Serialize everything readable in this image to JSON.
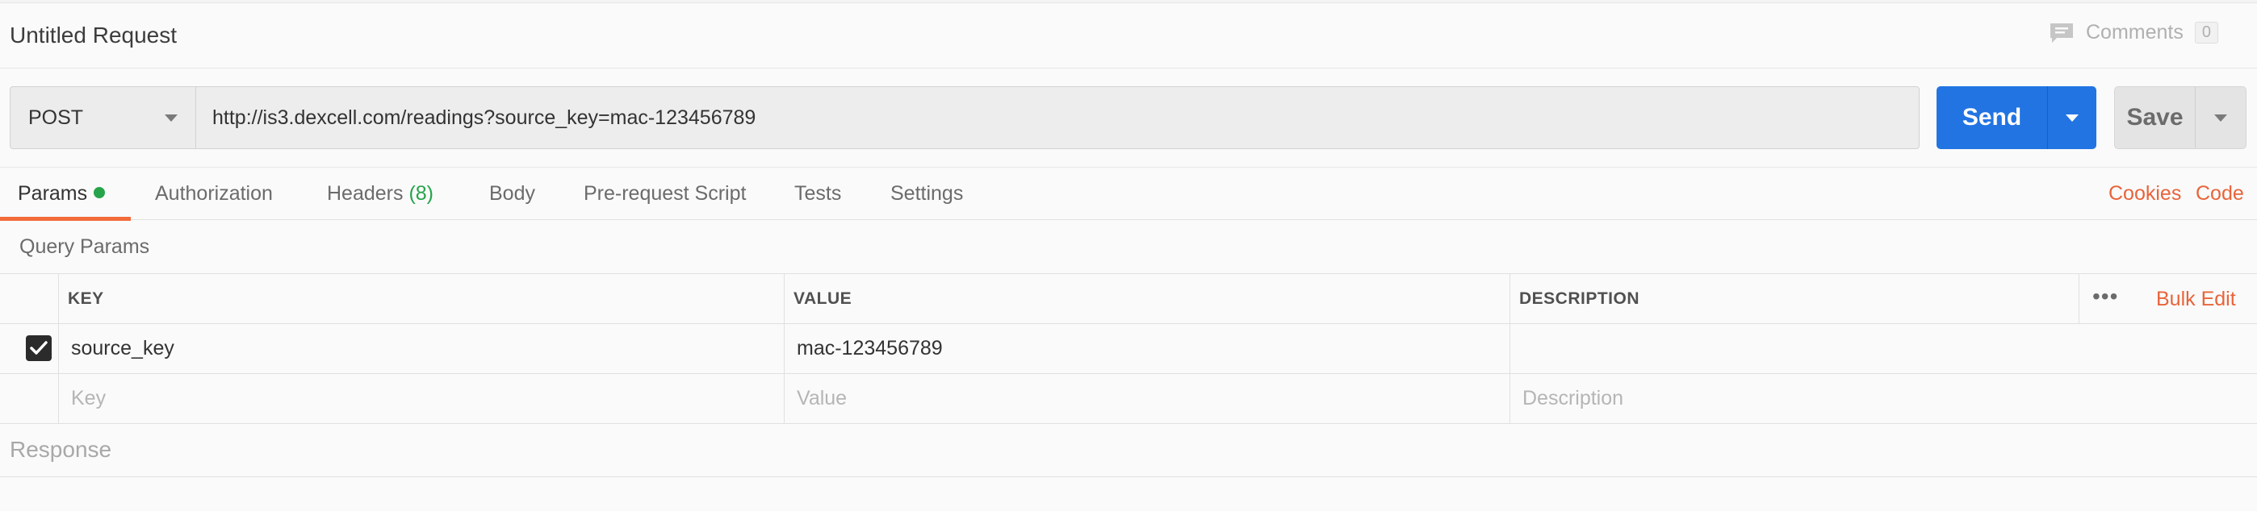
{
  "header": {
    "title": "Untitled Request",
    "comments_label": "Comments",
    "comments_count": "0"
  },
  "request": {
    "method": "POST",
    "url": "http://is3.dexcell.com/readings?source_key=mac-123456789",
    "send_label": "Send",
    "save_label": "Save"
  },
  "tabs": [
    {
      "label": "Params",
      "active": true
    },
    {
      "label": "Authorization"
    },
    {
      "label": "Headers",
      "count": "(8)"
    },
    {
      "label": "Body"
    },
    {
      "label": "Pre-request Script"
    },
    {
      "label": "Tests"
    },
    {
      "label": "Settings"
    }
  ],
  "tab_links": {
    "cookies": "Cookies",
    "code": "Code"
  },
  "query_params": {
    "title": "Query Params",
    "columns": {
      "key": "KEY",
      "value": "VALUE",
      "description": "DESCRIPTION"
    },
    "more_label": "•••",
    "bulk_edit": "Bulk Edit",
    "rows": [
      {
        "checked": true,
        "key": "source_key",
        "value": "mac-123456789",
        "description": ""
      }
    ],
    "placeholders": {
      "key": "Key",
      "value": "Value",
      "description": "Description"
    }
  },
  "response": {
    "label": "Response"
  },
  "colors": {
    "accent": "#f26b3a",
    "send": "#2274e3",
    "green": "#26a44a"
  }
}
